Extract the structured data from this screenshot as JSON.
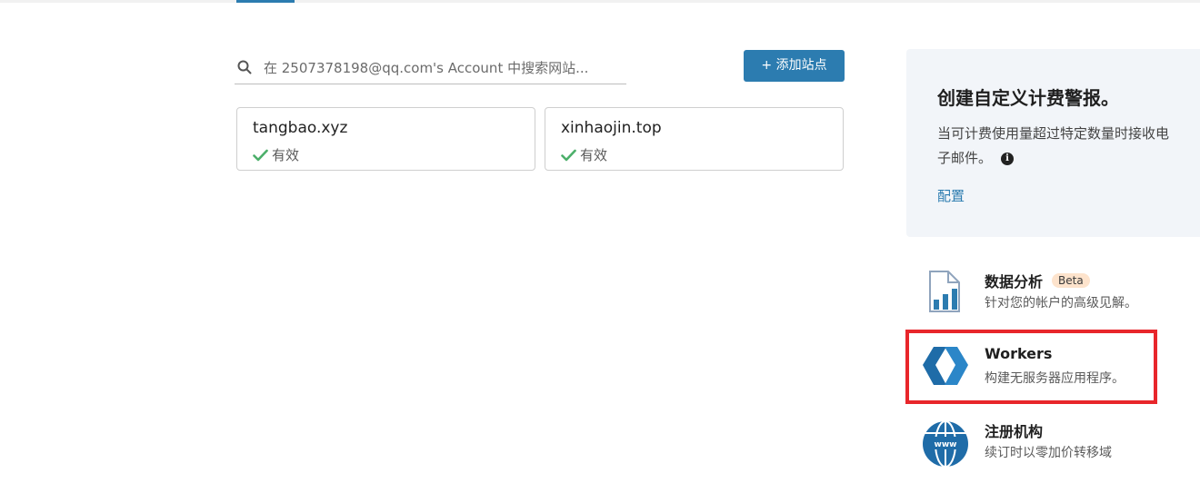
{
  "search": {
    "placeholder": "在 2507378198@qq.com's Account 中搜索网站..."
  },
  "add_site_button": "+ 添加站点",
  "sites": [
    {
      "name": "tangbao.xyz",
      "status": "有效"
    },
    {
      "name": "xinhaojin.top",
      "status": "有效"
    }
  ],
  "alert": {
    "title": "创建自定义计费警报。",
    "desc_line1": "当可计费使用量超过特定数量时接收电",
    "desc_line2": "子邮件。",
    "link": "配置"
  },
  "products": [
    {
      "title": "数据分析",
      "badge": "Beta",
      "desc": "针对您的帐户的高级见解。",
      "icon": "analytics-icon"
    },
    {
      "title": "Workers",
      "desc": "构建无服务器应用程序。",
      "icon": "workers-icon"
    },
    {
      "title": "注册机构",
      "desc": "续订时以零加价转移域",
      "icon": "registrar-globe-icon"
    }
  ],
  "colors": {
    "accent": "#2c7cb0",
    "success": "#4caf6a",
    "highlight": "#e8262b",
    "panel_bg": "#f2f5f9",
    "badge_bg": "#fde3cc"
  }
}
